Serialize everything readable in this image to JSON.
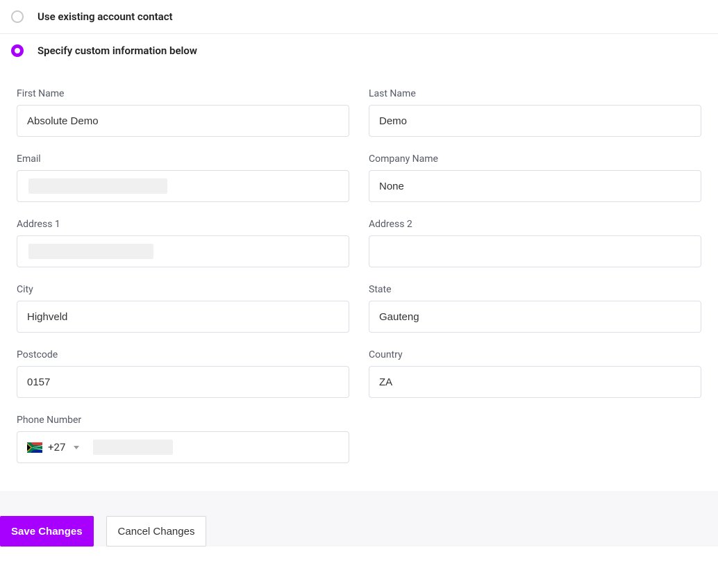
{
  "options": {
    "existing_label": "Use existing account contact",
    "custom_label": "Specify custom information below"
  },
  "form": {
    "first_name": {
      "label": "First Name",
      "value": "Absolute Demo"
    },
    "last_name": {
      "label": "Last Name",
      "value": "Demo"
    },
    "email": {
      "label": "Email",
      "value": ""
    },
    "company": {
      "label": "Company Name",
      "value": "None"
    },
    "address1": {
      "label": "Address 1",
      "value": ""
    },
    "address2": {
      "label": "Address 2",
      "value": ""
    },
    "city": {
      "label": "City",
      "value": "Highveld"
    },
    "state": {
      "label": "State",
      "value": "Gauteng"
    },
    "postcode": {
      "label": "Postcode",
      "value": "0157"
    },
    "country": {
      "label": "Country",
      "value": "ZA"
    },
    "phone": {
      "label": "Phone Number",
      "dial_code": "+27",
      "value": ""
    }
  },
  "footer": {
    "save_label": "Save Changes",
    "cancel_label": "Cancel Changes"
  }
}
